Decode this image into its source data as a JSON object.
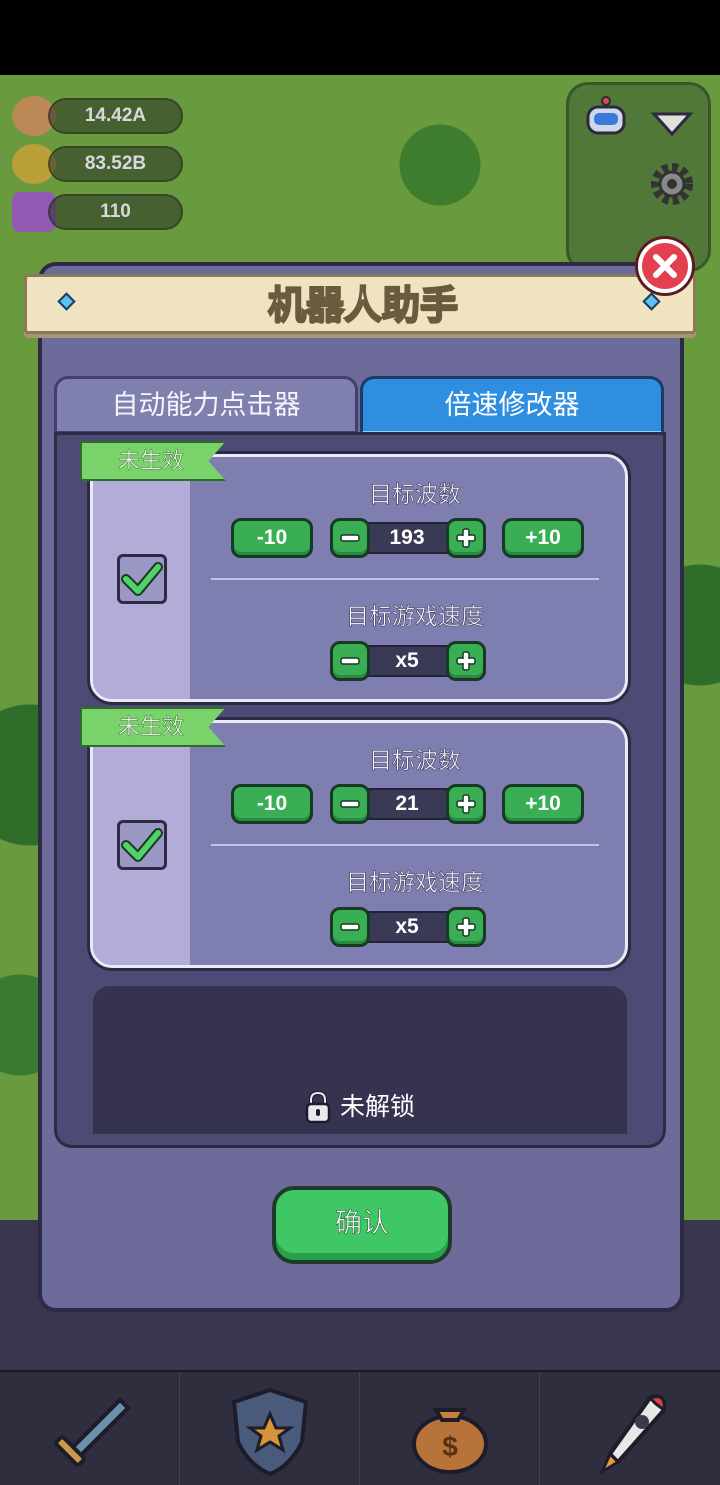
{
  "hud": {
    "resources": [
      {
        "name": "meat",
        "value": "14.42A"
      },
      {
        "name": "gold",
        "value": "83.52B"
      },
      {
        "name": "gem",
        "value": "110"
      }
    ]
  },
  "dialog": {
    "title": "机器人助手",
    "tabs": [
      {
        "label": "自动能力点击器",
        "active": false
      },
      {
        "label": "倍速修改器",
        "active": true
      }
    ],
    "cards": [
      {
        "status": "未生效",
        "checked": true,
        "target_wave_label": "目标波数",
        "target_wave": "193",
        "minus10_label": "-10",
        "plus10_label": "+10",
        "target_speed_label": "目标游戏速度",
        "target_speed": "x5"
      },
      {
        "status": "未生效",
        "checked": true,
        "target_wave_label": "目标波数",
        "target_wave": "21",
        "minus10_label": "-10",
        "plus10_label": "+10",
        "target_speed_label": "目标游戏速度",
        "target_speed": "x5"
      }
    ],
    "locked_label": "未解锁",
    "confirm_label": "确认"
  },
  "colors": {
    "dialog_bg": "#6c6b9a",
    "active_tab": "#2f8ee0",
    "green_button": "#3aae55",
    "status_tag": "#7ad36a",
    "close_button": "#e2404e"
  },
  "nav": [
    {
      "icon": "sword-icon"
    },
    {
      "icon": "shield-star-icon"
    },
    {
      "icon": "money-bag-icon"
    },
    {
      "icon": "rocket-icon"
    }
  ]
}
